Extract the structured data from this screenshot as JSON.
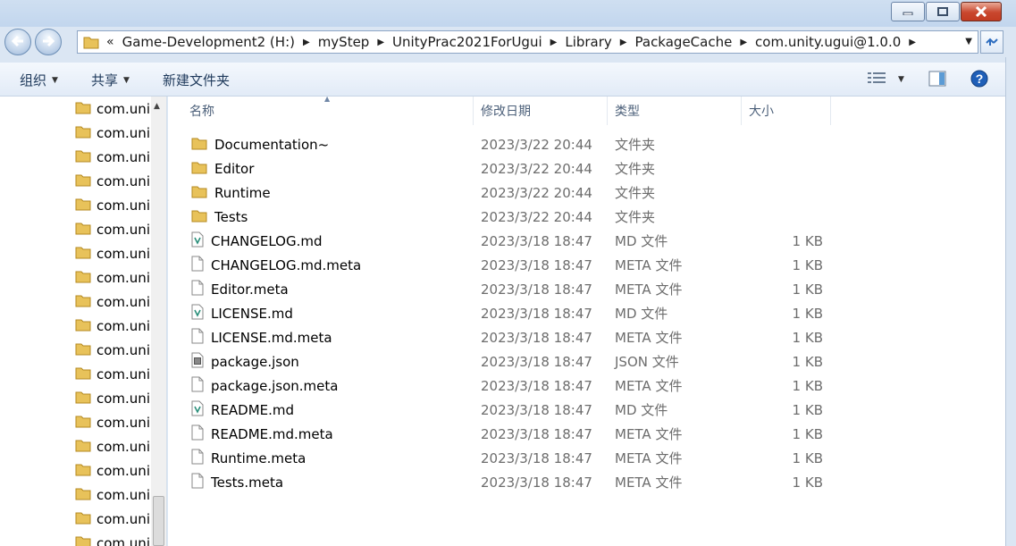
{
  "window": {
    "minimize_icon": "minimize-icon",
    "maximize_icon": "maximize-icon",
    "close_icon": "close-icon"
  },
  "address": {
    "overflow": "«",
    "crumbs": [
      "Game-Development2 (H:)",
      "myStep",
      "UnityPrac2021ForUgui",
      "Library",
      "PackageCache",
      "com.unity.ugui@1.0.0"
    ]
  },
  "toolbar": {
    "organize_label": "组织",
    "share_label": "共享",
    "new_folder_label": "新建文件夹"
  },
  "navpane": {
    "items": [
      "com.uni",
      "com.uni",
      "com.uni",
      "com.uni",
      "com.uni",
      "com.uni",
      "com.uni",
      "com.uni",
      "com.uni",
      "com.uni",
      "com.uni",
      "com.uni",
      "com.uni",
      "com.uni",
      "com.uni",
      "com.uni",
      "com.uni",
      "com.uni",
      "com.uni"
    ]
  },
  "columns": {
    "name": "名称",
    "date": "修改日期",
    "type": "类型",
    "size": "大小"
  },
  "files": [
    {
      "name": "Documentation~",
      "date": "2023/3/22 20:44",
      "type": "文件夹",
      "size": "",
      "icon": "folder-icon"
    },
    {
      "name": "Editor",
      "date": "2023/3/22 20:44",
      "type": "文件夹",
      "size": "",
      "icon": "folder-icon"
    },
    {
      "name": "Runtime",
      "date": "2023/3/22 20:44",
      "type": "文件夹",
      "size": "",
      "icon": "folder-icon"
    },
    {
      "name": "Tests",
      "date": "2023/3/22 20:44",
      "type": "文件夹",
      "size": "",
      "icon": "folder-icon"
    },
    {
      "name": "CHANGELOG.md",
      "date": "2023/3/18 18:47",
      "type": "MD 文件",
      "size": "1 KB",
      "icon": "md-file-icon"
    },
    {
      "name": "CHANGELOG.md.meta",
      "date": "2023/3/18 18:47",
      "type": "META 文件",
      "size": "1 KB",
      "icon": "file-icon"
    },
    {
      "name": "Editor.meta",
      "date": "2023/3/18 18:47",
      "type": "META 文件",
      "size": "1 KB",
      "icon": "file-icon"
    },
    {
      "name": "LICENSE.md",
      "date": "2023/3/18 18:47",
      "type": "MD 文件",
      "size": "1 KB",
      "icon": "md-file-icon"
    },
    {
      "name": "LICENSE.md.meta",
      "date": "2023/3/18 18:47",
      "type": "META 文件",
      "size": "1 KB",
      "icon": "file-icon"
    },
    {
      "name": "package.json",
      "date": "2023/3/18 18:47",
      "type": "JSON 文件",
      "size": "1 KB",
      "icon": "json-file-icon"
    },
    {
      "name": "package.json.meta",
      "date": "2023/3/18 18:47",
      "type": "META 文件",
      "size": "1 KB",
      "icon": "file-icon"
    },
    {
      "name": "README.md",
      "date": "2023/3/18 18:47",
      "type": "MD 文件",
      "size": "1 KB",
      "icon": "md-file-icon"
    },
    {
      "name": "README.md.meta",
      "date": "2023/3/18 18:47",
      "type": "META 文件",
      "size": "1 KB",
      "icon": "file-icon"
    },
    {
      "name": "Runtime.meta",
      "date": "2023/3/18 18:47",
      "type": "META 文件",
      "size": "1 KB",
      "icon": "file-icon"
    },
    {
      "name": "Tests.meta",
      "date": "2023/3/18 18:47",
      "type": "META 文件",
      "size": "1 KB",
      "icon": "file-icon"
    }
  ],
  "colors": {
    "folder": "#e8c25a",
    "accent": "#1e395b",
    "muted_text": "#6d6d6d"
  }
}
